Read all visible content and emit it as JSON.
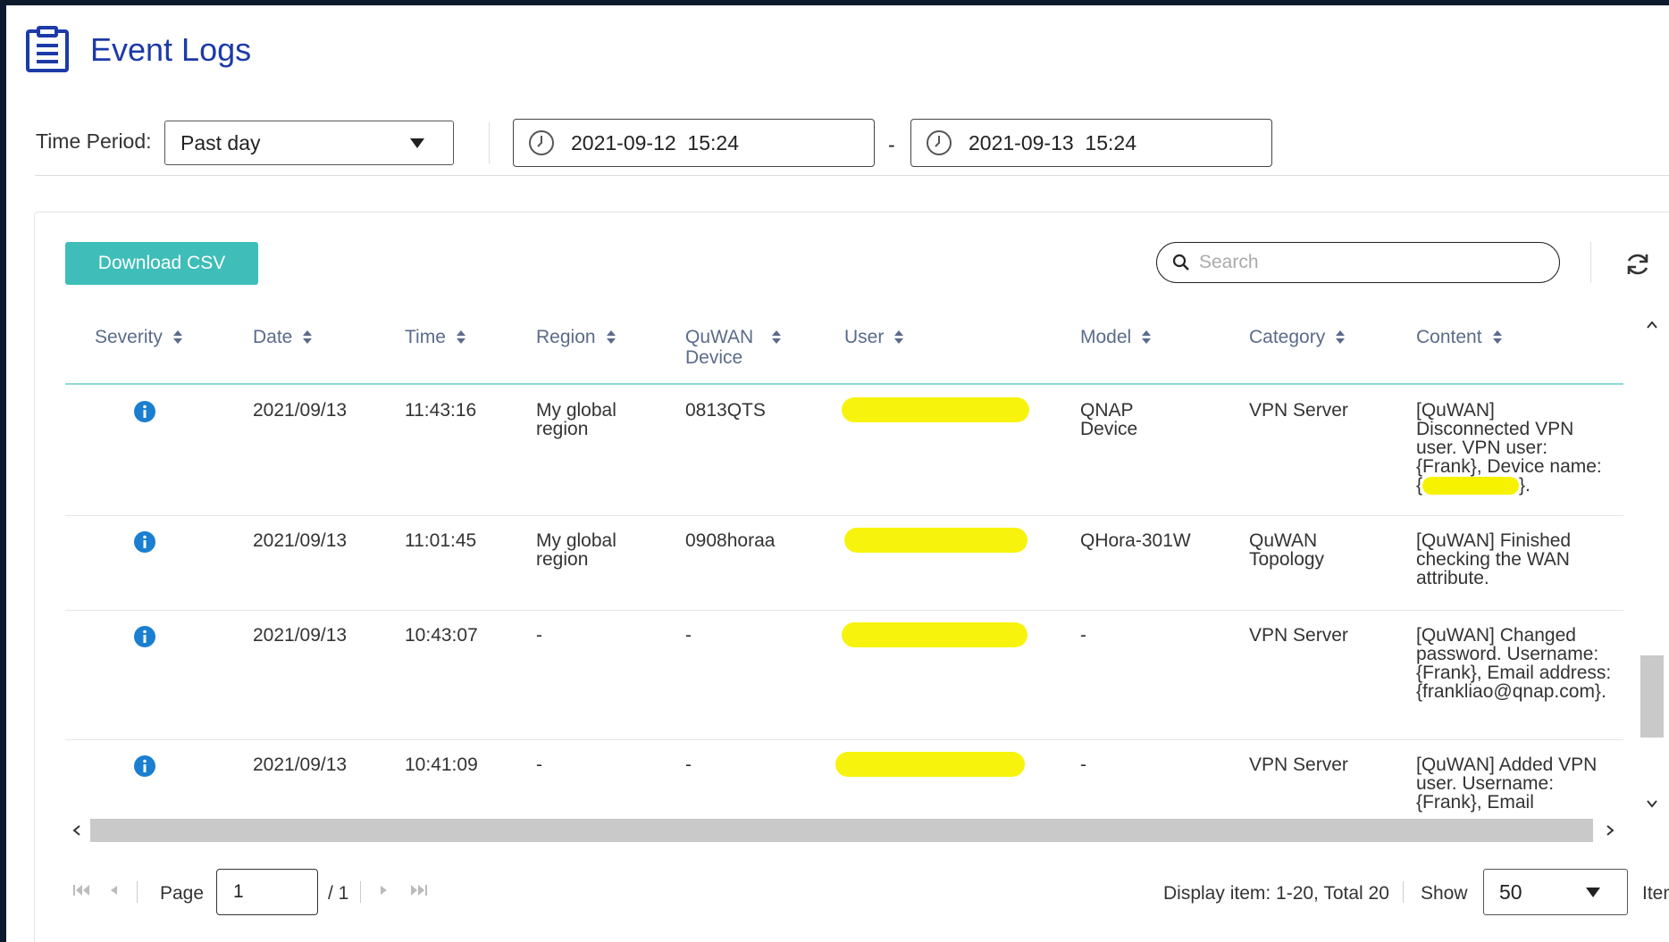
{
  "page": {
    "title": "Event Logs"
  },
  "filter": {
    "time_period_label": "Time Period:",
    "time_period_value": "Past day",
    "start_datetime": "2021-09-12  15:24",
    "end_datetime": "2021-09-13  15:24",
    "range_separator": "-"
  },
  "toolbar": {
    "download_label": "Download CSV",
    "search_placeholder": "Search"
  },
  "table": {
    "columns": [
      {
        "label": "Severity"
      },
      {
        "label": "Date"
      },
      {
        "label": "Time"
      },
      {
        "label": "Region"
      },
      {
        "label": "QuWAN Device"
      },
      {
        "label": "User"
      },
      {
        "label": "Model"
      },
      {
        "label": "Category"
      },
      {
        "label": "Content"
      }
    ],
    "rows": [
      {
        "severity": "info",
        "date": "2021/09/13",
        "time": "11:43:16",
        "region": "My global region",
        "device": "0813QTS",
        "model": "QNAP Device",
        "category": "VPN Server",
        "content": "[QuWAN] Disconnected VPN user. VPN user: {Frank}, Device name:",
        "content_end": "}."
      },
      {
        "severity": "info",
        "date": "2021/09/13",
        "time": "11:01:45",
        "region": "My global region",
        "device": "0908horaa",
        "model": "QHora-301W",
        "category": "QuWAN Topology",
        "content": "[QuWAN] Finished checking the WAN attribute."
      },
      {
        "severity": "info",
        "date": "2021/09/13",
        "time": "10:43:07",
        "region": "-",
        "device": "-",
        "model": "-",
        "category": "VPN Server",
        "content": "[QuWAN] Changed password. Username: {Frank}, Email address: {frankliao@qnap.com}."
      },
      {
        "severity": "info",
        "date": "2021/09/13",
        "time": "10:41:09",
        "region": "-",
        "device": "-",
        "model": "-",
        "category": "VPN Server",
        "content": "[QuWAN] Added VPN user. Username: {Frank}, Email"
      }
    ]
  },
  "pagination": {
    "page_label": "Page",
    "page_value": "1",
    "page_total": "/ 1",
    "display_info": "Display item: 1-20, Total 20",
    "show_label": "Show",
    "show_value": "50",
    "items_label": "Items"
  },
  "colors": {
    "title": "#1c3aa8",
    "button": "#3fbdb8",
    "info_icon": "#1a7fd0",
    "header_text": "#5a6b8a",
    "redaction": "#f7f200"
  }
}
